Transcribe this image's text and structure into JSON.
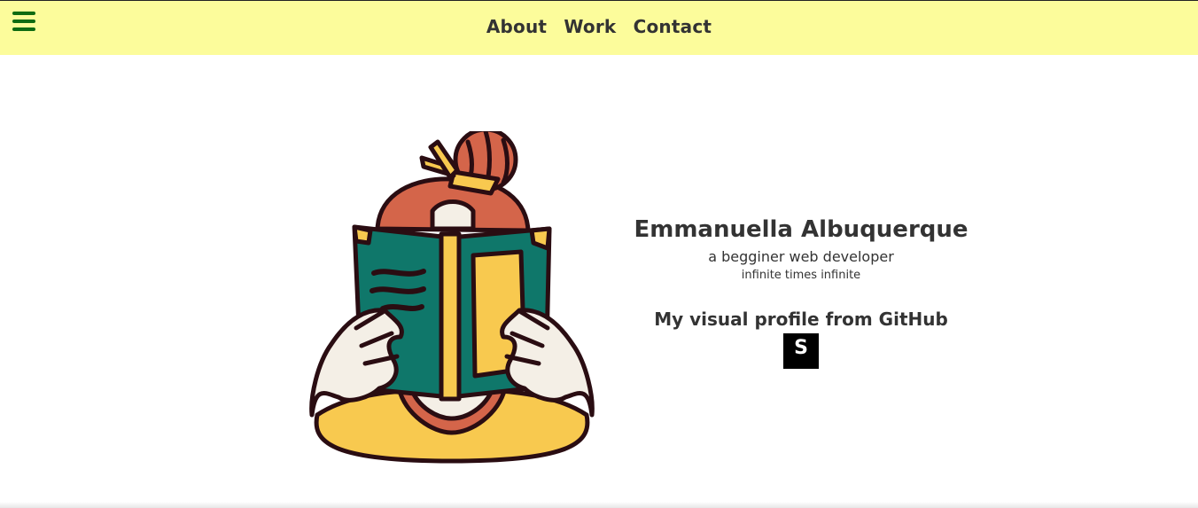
{
  "nav": {
    "menu_icon": "hamburger-menu-icon",
    "links": [
      "About",
      "Work",
      "Contact"
    ]
  },
  "hero": {
    "illustration": "person-reading-book-illustration"
  },
  "profile": {
    "name": "Emmanuella Albuquerque",
    "role": "a begginer web developer",
    "tagline": "infinite times infinite",
    "github_title": "My visual profile from GitHub",
    "github_badge_text": "S"
  },
  "colors": {
    "header_bg": "#fcfc9b",
    "menu_icon": "#0f6b12",
    "text": "#333333"
  }
}
